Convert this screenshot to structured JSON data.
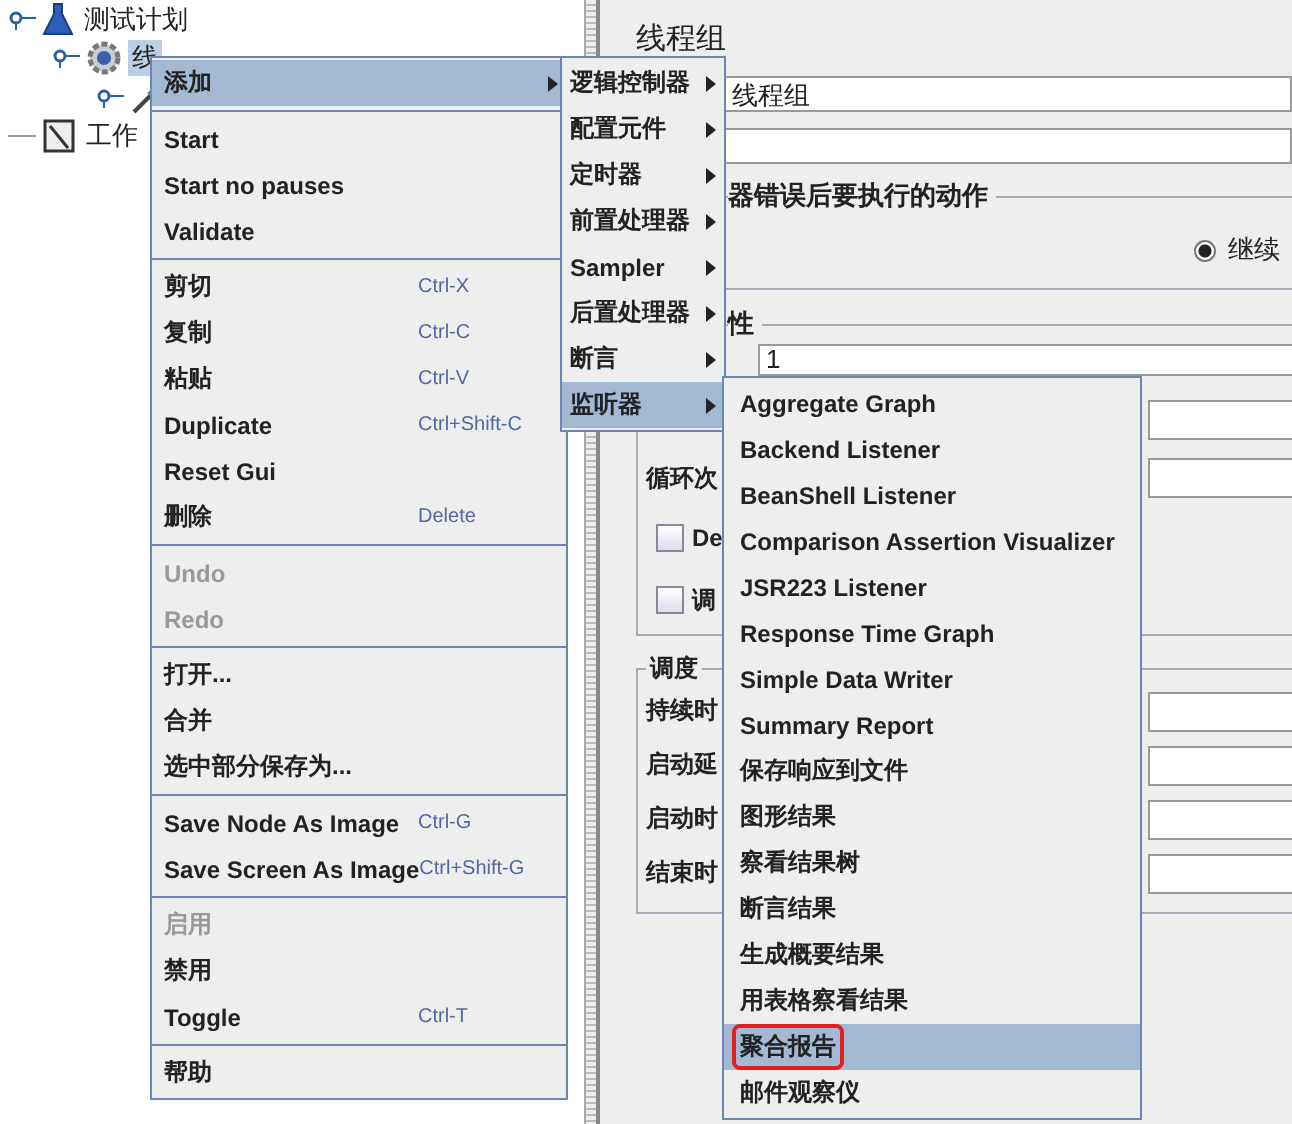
{
  "tree": [
    {
      "label": "测试计划",
      "kind": "plan",
      "expanded": true,
      "selected": false,
      "children": [
        {
          "label": "线",
          "kind": "thread-group",
          "expanded": true,
          "selected": true,
          "children": [
            {
              "kind": "sampler",
              "expanded": true
            }
          ]
        }
      ]
    },
    {
      "label": "工作",
      "kind": "workbench",
      "expanded": false,
      "selected": false
    }
  ],
  "panel": {
    "title": "线程组",
    "name_value": "线程组",
    "error_group": {
      "legend": "器错误后要执行的动作",
      "radios": [
        {
          "label": "继续",
          "selected": true
        }
      ]
    },
    "thread_group": {
      "legend": "性",
      "threads_value": "1",
      "loop_label": "循环次",
      "checkboxes": [
        {
          "label": "De",
          "checked": false
        },
        {
          "label": "调",
          "checked": false
        }
      ]
    },
    "scheduler": {
      "legend": "调度",
      "rows": [
        "持续时",
        "启动延",
        "启动时",
        "结束时"
      ]
    }
  },
  "context_menu": [
    [
      {
        "label": "添加",
        "submenu": true,
        "selected": true,
        "disabled": false
      }
    ],
    [
      {
        "label": "Start",
        "selected": false,
        "disabled": false
      },
      {
        "label": "Start no pauses",
        "selected": false,
        "disabled": false
      },
      {
        "label": "Validate",
        "selected": false,
        "disabled": false
      }
    ],
    [
      {
        "label": "剪切",
        "shortcut": "Ctrl-X",
        "selected": false,
        "disabled": false
      },
      {
        "label": "复制",
        "shortcut": "Ctrl-C",
        "selected": false,
        "disabled": false
      },
      {
        "label": "粘贴",
        "shortcut": "Ctrl-V",
        "selected": false,
        "disabled": false
      },
      {
        "label": "Duplicate",
        "shortcut": "Ctrl+Shift-C",
        "selected": false,
        "disabled": false
      },
      {
        "label": "Reset Gui",
        "selected": false,
        "disabled": false
      },
      {
        "label": "删除",
        "shortcut": "Delete",
        "selected": false,
        "disabled": false
      }
    ],
    [
      {
        "label": "Undo",
        "selected": false,
        "disabled": true
      },
      {
        "label": "Redo",
        "selected": false,
        "disabled": true
      }
    ],
    [
      {
        "label": "打开...",
        "selected": false,
        "disabled": false
      },
      {
        "label": "合并",
        "selected": false,
        "disabled": false
      },
      {
        "label": "选中部分保存为...",
        "selected": false,
        "disabled": false
      }
    ],
    [
      {
        "label": "Save Node As Image",
        "shortcut": "Ctrl-G",
        "selected": false,
        "disabled": false
      },
      {
        "label": "Save Screen As Image",
        "shortcut": "Ctrl+Shift-G",
        "selected": false,
        "disabled": false
      }
    ],
    [
      {
        "label": "启用",
        "selected": false,
        "disabled": true
      },
      {
        "label": "禁用",
        "selected": false,
        "disabled": false
      },
      {
        "label": "Toggle",
        "shortcut": "Ctrl-T",
        "selected": false,
        "disabled": false
      }
    ],
    [
      {
        "label": "帮助",
        "selected": false,
        "disabled": false
      }
    ]
  ],
  "add_submenu": [
    {
      "label": "逻辑控制器",
      "selected": false
    },
    {
      "label": "配置元件",
      "selected": false
    },
    {
      "label": "定时器",
      "selected": false
    },
    {
      "label": "前置处理器",
      "selected": false
    },
    {
      "label": "Sampler",
      "selected": false
    },
    {
      "label": "后置处理器",
      "selected": false
    },
    {
      "label": "断言",
      "selected": false
    },
    {
      "label": "监听器",
      "selected": true
    }
  ],
  "listener_submenu": [
    {
      "label": "Aggregate Graph",
      "selected": false,
      "highlighted": false
    },
    {
      "label": "Backend Listener",
      "selected": false,
      "highlighted": false
    },
    {
      "label": "BeanShell Listener",
      "selected": false,
      "highlighted": false
    },
    {
      "label": "Comparison Assertion Visualizer",
      "selected": false,
      "highlighted": false
    },
    {
      "label": "JSR223 Listener",
      "selected": false,
      "highlighted": false
    },
    {
      "label": "Response Time Graph",
      "selected": false,
      "highlighted": false
    },
    {
      "label": "Simple Data Writer",
      "selected": false,
      "highlighted": false
    },
    {
      "label": "Summary Report",
      "selected": false,
      "highlighted": false
    },
    {
      "label": "保存响应到文件",
      "selected": false,
      "highlighted": false
    },
    {
      "label": "图形结果",
      "selected": false,
      "highlighted": false
    },
    {
      "label": "察看结果树",
      "selected": false,
      "highlighted": false
    },
    {
      "label": "断言结果",
      "selected": false,
      "highlighted": false
    },
    {
      "label": "生成概要结果",
      "selected": false,
      "highlighted": false
    },
    {
      "label": "用表格察看结果",
      "selected": false,
      "highlighted": false
    },
    {
      "label": "聚合报告",
      "selected": true,
      "highlighted": true
    },
    {
      "label": "邮件观察仪",
      "selected": false,
      "highlighted": false
    }
  ]
}
